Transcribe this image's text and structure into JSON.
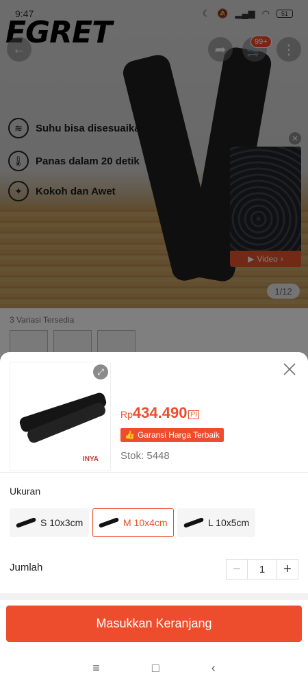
{
  "statusbar": {
    "time": "9:47",
    "battery": "51"
  },
  "brand_logo": "EGRET",
  "header": {
    "cart_badge": "99+"
  },
  "features": [
    {
      "icon": "heat-icon",
      "label": "Suhu bisa disesuaikan"
    },
    {
      "icon": "thermometer-icon",
      "label": "Panas dalam 20 detik"
    },
    {
      "icon": "shield-icon",
      "label": "Kokoh dan Awet"
    }
  ],
  "video": {
    "label": "Video"
  },
  "image_counter": "1/12",
  "variants_available": "3 Variasi Tersedia",
  "sheet": {
    "price_currency": "Rp",
    "price_value": "434.490",
    "price_tag": "PI",
    "guarantee_label": "Garansi Harga Terbaik",
    "stock": "Stok: 5448",
    "product_logo": "INYA",
    "size_label": "Ukuran",
    "options": [
      {
        "label": "S 10x3cm",
        "selected": false
      },
      {
        "label": "M 10x4cm",
        "selected": true
      },
      {
        "label": "L 10x5cm",
        "selected": false
      }
    ],
    "quantity_label": "Jumlah",
    "quantity_value": "1",
    "cta_label": "Masukkan Keranjang"
  },
  "colors": {
    "accent": "#ee4d2d",
    "overlay": "rgba(0,0,0,0.5)"
  }
}
